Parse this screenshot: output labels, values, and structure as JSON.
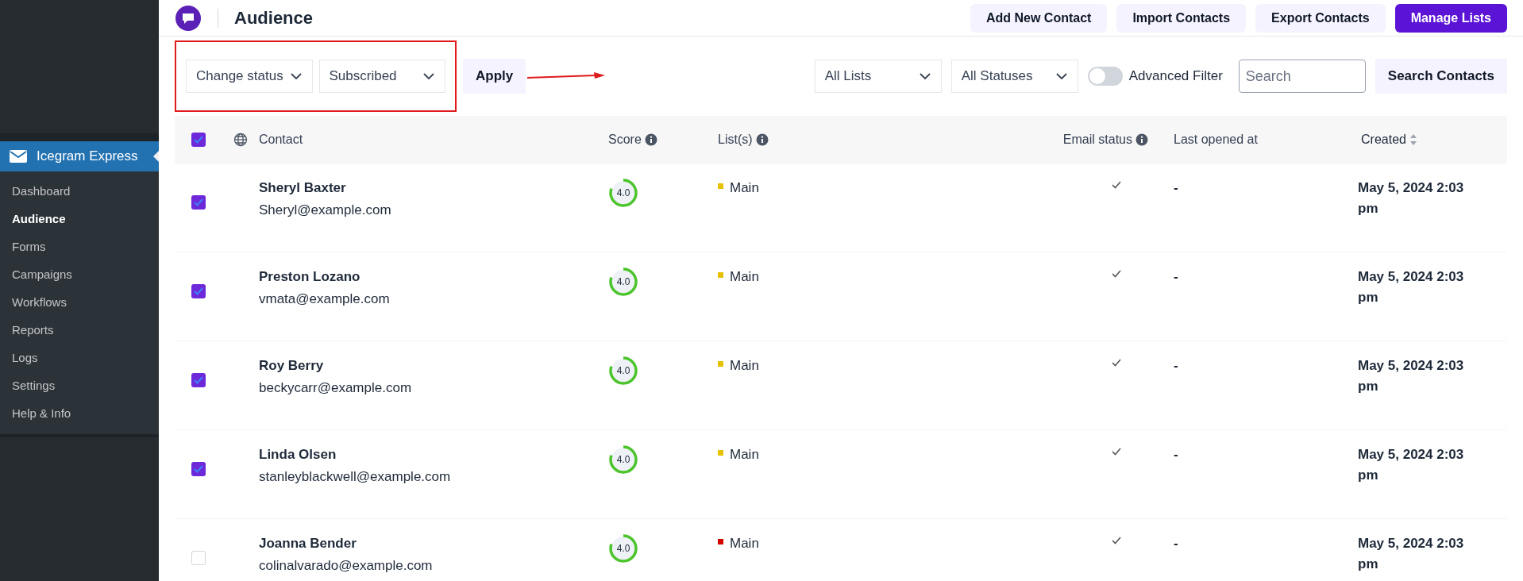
{
  "sidebar": {
    "plugin": {
      "label": "Icegram Express",
      "selected": true
    },
    "items": [
      {
        "label": "Dashboard",
        "selected": false
      },
      {
        "label": "Audience",
        "selected": true
      },
      {
        "label": "Forms",
        "selected": false
      },
      {
        "label": "Campaigns",
        "selected": false
      },
      {
        "label": "Workflows",
        "selected": false
      },
      {
        "label": "Reports",
        "selected": false
      },
      {
        "label": "Logs",
        "selected": false
      },
      {
        "label": "Settings",
        "selected": false
      },
      {
        "label": "Help & Info",
        "selected": false
      }
    ]
  },
  "header": {
    "title": "Audience",
    "buttons": [
      {
        "label": "Add New Contact",
        "primary": false
      },
      {
        "label": "Import Contacts",
        "primary": false
      },
      {
        "label": "Export Contacts",
        "primary": false
      },
      {
        "label": "Manage Lists",
        "primary": true
      }
    ]
  },
  "bulk_actions": {
    "action": "Change status",
    "status": "Subscribed",
    "apply": "Apply"
  },
  "filters": {
    "list": "All Lists",
    "status": "All Statuses",
    "advanced_filter": {
      "label": "Advanced Filter",
      "on": false
    },
    "search": {
      "placeholder": "Search"
    },
    "search_button": "Search Contacts"
  },
  "table": {
    "select_all": {
      "checked": true
    },
    "columns": [
      {
        "label": "Contact",
        "info": false,
        "sortable": false
      },
      {
        "label": "Score",
        "info": true,
        "sortable": false
      },
      {
        "label": "List(s)",
        "info": true,
        "sortable": false
      },
      {
        "label": "Email status",
        "info": true,
        "sortable": false
      },
      {
        "label": "Last opened at",
        "info": false,
        "sortable": false
      },
      {
        "label": "Created",
        "info": false,
        "sortable": true
      }
    ],
    "rows": [
      {
        "checked": true,
        "name": "Sheryl Baxter",
        "email": "Sheryl@example.com",
        "score": "4.0",
        "list": "Main",
        "color": "#e5c100",
        "last_opened": "-",
        "created": "May 5, 2024 2:03 pm"
      },
      {
        "checked": true,
        "name": "Preston Lozano",
        "email": "vmata@example.com",
        "score": "4.0",
        "list": "Main",
        "color": "#e5c100",
        "last_opened": "-",
        "created": "May 5, 2024 2:03 pm"
      },
      {
        "checked": true,
        "name": "Roy Berry",
        "email": "beckycarr@example.com",
        "score": "4.0",
        "list": "Main",
        "color": "#e5c100",
        "last_opened": "-",
        "created": "May 5, 2024 2:03 pm"
      },
      {
        "checked": true,
        "name": "Linda Olsen",
        "email": "stanleyblackwell@example.com",
        "score": "4.0",
        "list": "Main",
        "color": "#e5c100",
        "last_opened": "-",
        "created": "May 5, 2024 2:03 pm"
      },
      {
        "checked": false,
        "name": "Joanna Bender",
        "email": "colinalvarado@example.com",
        "score": "4.0",
        "list": "Main",
        "color": "#d40000",
        "last_opened": "-",
        "created": "May 5, 2024 2:03 pm"
      }
    ]
  }
}
